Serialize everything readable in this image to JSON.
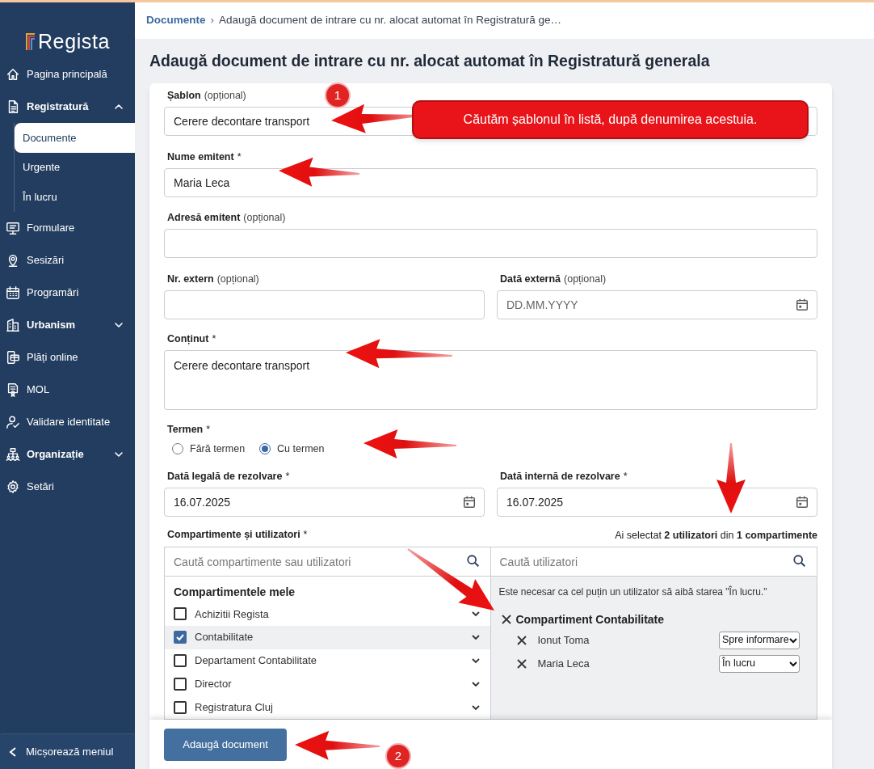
{
  "logo": "Regista",
  "sidebar": {
    "items": [
      {
        "kind": "link",
        "label": "Pagina principală"
      },
      {
        "kind": "group",
        "label": "Registratură",
        "expanded": true,
        "children": [
          {
            "label": "Documente",
            "selected": true
          },
          {
            "label": "Urgente",
            "selected": false
          },
          {
            "label": "În lucru",
            "selected": false
          }
        ]
      },
      {
        "kind": "link",
        "label": "Formulare"
      },
      {
        "kind": "link",
        "label": "Sesizări"
      },
      {
        "kind": "link",
        "label": "Programări"
      },
      {
        "kind": "group",
        "label": "Urbanism",
        "expanded": false
      },
      {
        "kind": "link",
        "label": "Plăți online"
      },
      {
        "kind": "link",
        "label": "MOL"
      },
      {
        "kind": "link",
        "label": "Validare identitate"
      },
      {
        "kind": "group",
        "label": "Organizație",
        "expanded": false
      },
      {
        "kind": "link",
        "label": "Setări"
      }
    ],
    "collapse": "Micșorează meniul"
  },
  "breadcrumb": {
    "items": [
      "Documente",
      "Adaugă document de intrare cu nr. alocat automat în Registratură ge…"
    ],
    "separator": "›"
  },
  "title": "Adaugă document de intrare cu nr. alocat automat în Registratură generala",
  "form": {
    "sablon": {
      "label": "Șablon",
      "hint": "(opțional)",
      "value": "Cerere decontare transport"
    },
    "emitent": {
      "label": "Nume emitent",
      "required": "*",
      "value": "Maria Leca"
    },
    "adresa": {
      "label": "Adresă emitent",
      "hint": "(opțional)"
    },
    "nr_extern": {
      "label": "Nr. extern",
      "hint": "(opțional)"
    },
    "data_externa": {
      "label": "Dată externă",
      "hint": "(opțional)",
      "placeholder": "DD.MM.YYYY"
    },
    "continut": {
      "label": "Conținut",
      "required": "*",
      "value": "Cerere decontare transport"
    },
    "termen": {
      "label": "Termen",
      "required": "*",
      "options": [
        {
          "label": "Fără termen",
          "selected": false
        },
        {
          "label": "Cu termen",
          "selected": true
        }
      ]
    },
    "data_legala": {
      "label": "Dată legală de rezolvare",
      "required": "*",
      "value": "16.07.2025"
    },
    "data_interna": {
      "label": "Dată internă de rezolvare",
      "required": "*",
      "value": "16.07.2025"
    },
    "compartimente": {
      "label": "Compartimente și utilizatori",
      "required": "*",
      "summary": "Ai selectat **2 utilizatori** din **1 compartimente**",
      "search_left": {
        "placeholder": "Caută compartimente sau utilizatori"
      },
      "search_right": {
        "placeholder": "Caută utilizatori"
      },
      "list_title": "Compartimentele mele",
      "items": [
        {
          "label": "Achizitii Regista",
          "checked": false
        },
        {
          "label": "Contabilitate",
          "checked": true
        },
        {
          "label": "Departament Contabilitate",
          "checked": false
        },
        {
          "label": "Director",
          "checked": false
        },
        {
          "label": "Registratura Cluj",
          "checked": false
        }
      ],
      "notice": "Este necesar ca cel puțin un utilizator să aibă starea \"În lucru.\"",
      "selected_groups": [
        {
          "name": "Compartiment Contabilitate",
          "users": [
            {
              "name": "Ionut Toma",
              "role": "Spre informare"
            },
            {
              "name": "Maria Leca",
              "role": "În lucru"
            }
          ]
        }
      ]
    }
  },
  "submit": "Adaugă document",
  "annotations": {
    "callout": "Căutăm șablonul în listă, după denumirea acestuia.",
    "markers": [
      "1",
      "2"
    ]
  }
}
